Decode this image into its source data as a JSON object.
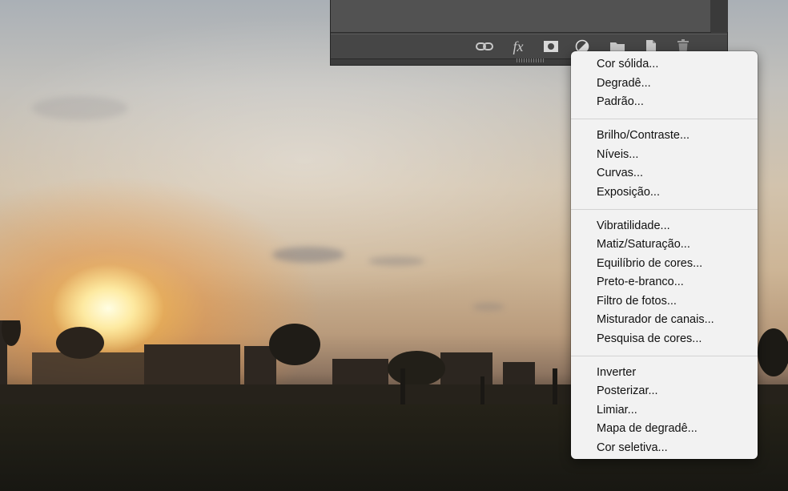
{
  "layers_panel": {
    "icons": [
      "link-icon",
      "fx-icon",
      "layer-mask-icon",
      "adjustment-layer-icon",
      "folder-icon",
      "new-layer-icon",
      "trash-icon"
    ],
    "fx_label": "fx"
  },
  "adjustment_menu": {
    "groups": [
      {
        "items": [
          "Cor sólida...",
          "Degradê...",
          "Padrão..."
        ]
      },
      {
        "items": [
          "Brilho/Contraste...",
          "Níveis...",
          "Curvas...",
          "Exposição..."
        ]
      },
      {
        "items": [
          "Vibratilidade...",
          "Matiz/Saturação...",
          "Equilíbrio de cores...",
          "Preto-e-branco...",
          "Filtro de fotos...",
          "Misturador de canais...",
          "Pesquisa de cores..."
        ]
      },
      {
        "items": [
          "Inverter",
          "Posterizar...",
          "Limiar...",
          "Mapa de degradê...",
          "Cor seletiva..."
        ]
      }
    ]
  },
  "colors": {
    "panel_bg": "#3c3c3c",
    "menu_bg": "#f2f2f2",
    "menu_text": "#111111"
  }
}
